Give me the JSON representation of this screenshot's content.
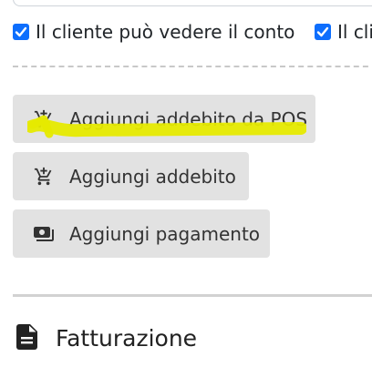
{
  "checkboxes": [
    {
      "label": "Il cliente può vedere il conto",
      "checked": true
    },
    {
      "label": "Il cli",
      "checked": true
    }
  ],
  "actions": {
    "pos_charge_label": "Aggiungi addebito da POS",
    "charge_label": "Aggiungi addebito",
    "payment_label": "Aggiungi pagamento"
  },
  "section": {
    "title": "Fatturazione"
  },
  "colors": {
    "checkbox": "#0d6efd",
    "button_bg": "#e2e2e2",
    "highlight": "#e6ea00"
  },
  "icons": {
    "pos_charge": "add-shopping-cart-icon",
    "charge": "add-shopping-cart-icon",
    "payment": "payments-icon",
    "section": "document-icon"
  }
}
